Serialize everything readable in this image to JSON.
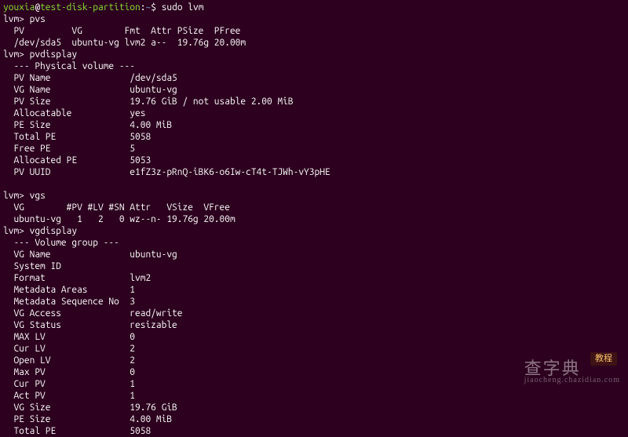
{
  "shell": {
    "user": "youxia",
    "host": "test-disk-partition",
    "path": "~",
    "symbol": "$",
    "command": "sudo lvm"
  },
  "lvm": {
    "prompt": "lvm>",
    "cmds": {
      "pvs": "pvs",
      "pvdisplay": "pvdisplay",
      "vgs": "vgs",
      "vgdisplay": "vgdisplay"
    }
  },
  "pvs": {
    "header": "  PV         VG        Fmt  Attr PSize  PFree",
    "row": "  /dev/sda5  ubuntu-vg lvm2 a--  19.76g 20.00m"
  },
  "pvdisplay": {
    "title": "  --- Physical volume ---",
    "rows": {
      "pv_name": "  PV Name               /dev/sda5",
      "vg_name": "  VG Name               ubuntu-vg",
      "pv_size": "  PV Size               19.76 GiB / not usable 2.00 MiB",
      "allocatable": "  Allocatable           yes",
      "pe_size": "  PE Size               4.00 MiB",
      "total_pe": "  Total PE              5058",
      "free_pe": "  Free PE               5",
      "alloc_pe": "  Allocated PE          5053",
      "pv_uuid": "  PV UUID               e1fZ3z-pRnQ-iBK6-o6Iw-cT4t-TJWh-vY3pHE"
    }
  },
  "vgs": {
    "header": "  VG        #PV #LV #SN Attr   VSize  VFree",
    "row": "  ubuntu-vg   1   2   0 wz--n- 19.76g 20.00m"
  },
  "vgdisplay": {
    "title": "  --- Volume group ---",
    "rows": {
      "vg_name": "  VG Name               ubuntu-vg",
      "system_id": "  System ID",
      "format": "  Format                lvm2",
      "md_areas": "  Metadata Areas        1",
      "md_seq": "  Metadata Sequence No  3",
      "vg_access": "  VG Access             read/write",
      "vg_status": "  VG Status             resizable",
      "max_lv": "  MAX LV                0",
      "cur_lv": "  Cur LV                2",
      "open_lv": "  Open LV               2",
      "max_pv": "  Max PV                0",
      "cur_pv": "  Cur PV                1",
      "act_pv": "  Act PV                1",
      "vg_size": "  VG Size               19.76 GiB",
      "pe_size": "  PE Size               4.00 MiB",
      "total_pe": "  Total PE              5058"
    }
  },
  "watermark": {
    "badge": "教程",
    "main": "查字典",
    "sub": "jiaocheng.chazidian.com"
  }
}
